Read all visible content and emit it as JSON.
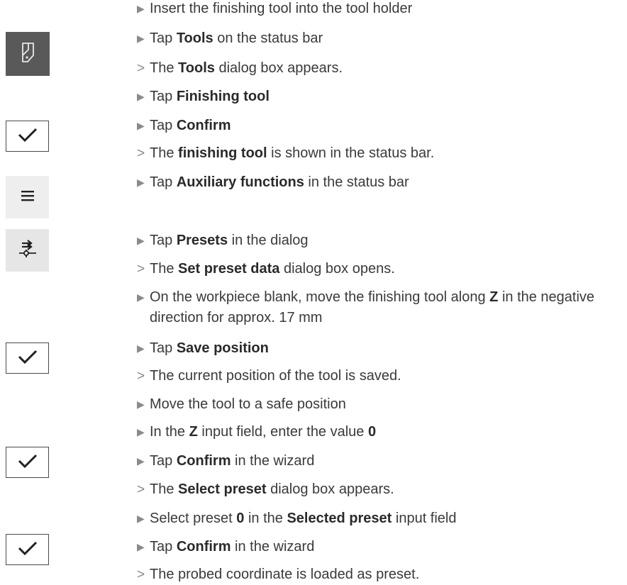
{
  "icons": {
    "tool": "finishing-tool-icon",
    "confirm": "checkmark-icon",
    "menu": "hamburger-menu-icon",
    "preset": "preset-probe-icon"
  },
  "markers": {
    "action": "▶",
    "result": ">"
  },
  "steps": [
    {
      "type": "action",
      "parts": [
        {
          "t": "Insert the finishing tool into the tool holder"
        }
      ]
    },
    {
      "type": "action",
      "parts": [
        {
          "t": "Tap "
        },
        {
          "t": "Tools",
          "b": true
        },
        {
          "t": " on the status bar"
        }
      ]
    },
    {
      "type": "result",
      "parts": [
        {
          "t": "The "
        },
        {
          "t": "Tools",
          "b": true
        },
        {
          "t": " dialog box appears."
        }
      ]
    },
    {
      "type": "action",
      "parts": [
        {
          "t": "Tap "
        },
        {
          "t": "Finishing tool",
          "b": true
        }
      ]
    },
    {
      "type": "action",
      "parts": [
        {
          "t": "Tap "
        },
        {
          "t": "Confirm",
          "b": true
        }
      ]
    },
    {
      "type": "result",
      "parts": [
        {
          "t": "The "
        },
        {
          "t": "finishing tool",
          "b": true
        },
        {
          "t": " is shown in the status bar."
        }
      ]
    },
    {
      "type": "action",
      "parts": [
        {
          "t": "Tap "
        },
        {
          "t": "Auxiliary functions",
          "b": true
        },
        {
          "t": " in the status bar"
        }
      ]
    },
    {
      "type": "action",
      "parts": [
        {
          "t": "Tap "
        },
        {
          "t": "Presets",
          "b": true
        },
        {
          "t": " in the dialog"
        }
      ]
    },
    {
      "type": "result",
      "parts": [
        {
          "t": "The "
        },
        {
          "t": "Set preset data",
          "b": true
        },
        {
          "t": " dialog box opens."
        }
      ]
    },
    {
      "type": "action",
      "parts": [
        {
          "t": "On the workpiece blank, move the finishing tool along "
        },
        {
          "t": "Z",
          "b": true
        },
        {
          "t": " in the negative direction for approx. 17 mm"
        }
      ]
    },
    {
      "type": "action",
      "parts": [
        {
          "t": "Tap "
        },
        {
          "t": "Save position",
          "b": true
        }
      ]
    },
    {
      "type": "result",
      "parts": [
        {
          "t": "The current position of the tool is saved."
        }
      ]
    },
    {
      "type": "action",
      "parts": [
        {
          "t": "Move the tool to a safe position"
        }
      ]
    },
    {
      "type": "action",
      "parts": [
        {
          "t": "In the "
        },
        {
          "t": "Z",
          "b": true
        },
        {
          "t": " input field, enter the value "
        },
        {
          "t": "0",
          "b": true
        }
      ]
    },
    {
      "type": "action",
      "parts": [
        {
          "t": "Tap "
        },
        {
          "t": "Confirm",
          "b": true
        },
        {
          "t": " in the wizard"
        }
      ]
    },
    {
      "type": "result",
      "parts": [
        {
          "t": "The "
        },
        {
          "t": "Select preset",
          "b": true
        },
        {
          "t": " dialog box appears."
        }
      ]
    },
    {
      "type": "action",
      "parts": [
        {
          "t": "Select preset "
        },
        {
          "t": "0",
          "b": true
        },
        {
          "t": " in the "
        },
        {
          "t": "Selected preset",
          "b": true
        },
        {
          "t": " input field"
        }
      ]
    },
    {
      "type": "action",
      "parts": [
        {
          "t": "Tap "
        },
        {
          "t": "Confirm",
          "b": true
        },
        {
          "t": " in the wizard"
        }
      ]
    },
    {
      "type": "result",
      "parts": [
        {
          "t": "The probed coordinate is loaded as preset."
        }
      ]
    }
  ]
}
